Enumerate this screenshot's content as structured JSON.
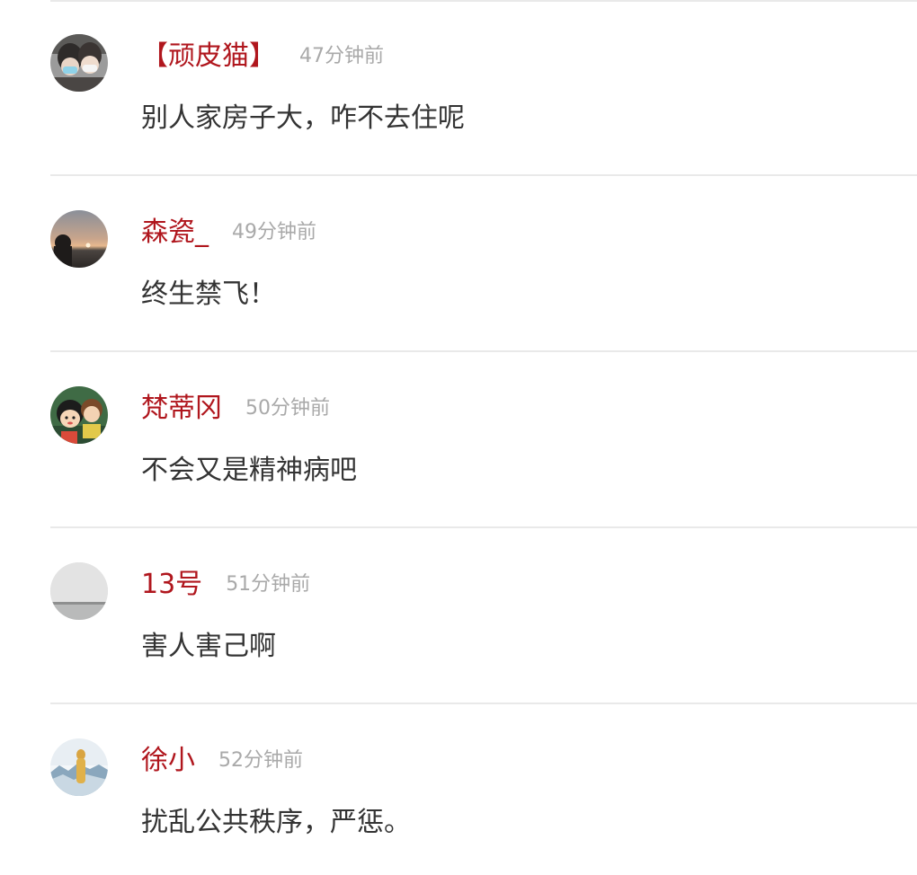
{
  "comments": [
    {
      "username": "【顽皮猫】",
      "time": "47分钟前",
      "text": "别人家房子大，咋不去住呢",
      "avatar": "avatar-couple-masks"
    },
    {
      "username": "森瓷_",
      "time": "49分钟前",
      "text": "终生禁飞！",
      "avatar": "avatar-sunset-silhouette"
    },
    {
      "username": "梵蒂冈",
      "time": "50分钟前",
      "text": "不会又是精神病吧",
      "avatar": "avatar-cartoon-girl"
    },
    {
      "username": "13号",
      "time": "51分钟前",
      "text": "害人害己啊",
      "avatar": "avatar-foggy-sea"
    },
    {
      "username": "徐小",
      "time": "52分钟前",
      "text": "扰乱公共秩序，严惩。",
      "avatar": "avatar-snow-landscape"
    }
  ],
  "colors": {
    "username": "#b0161d",
    "timestamp": "#a9a9a9",
    "body_text": "#333333",
    "divider": "#e9e9e9"
  }
}
